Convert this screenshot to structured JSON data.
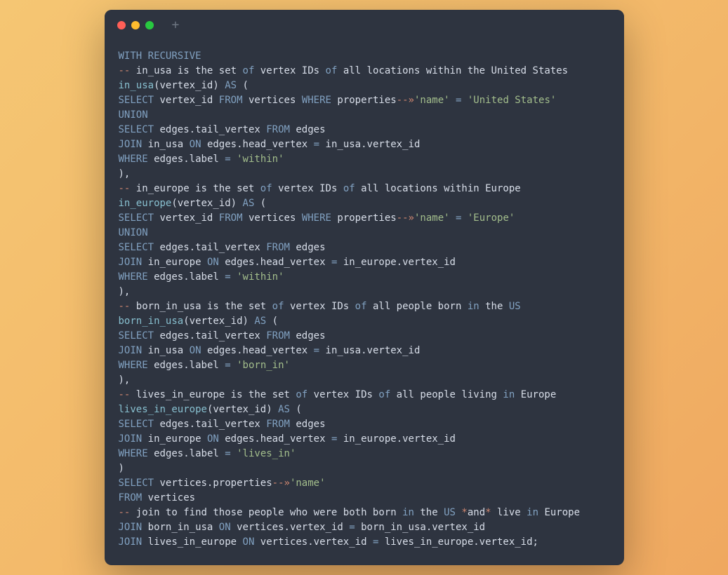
{
  "code": {
    "lines": [
      [
        {
          "t": "WITH RECURSIVE",
          "c": "kw"
        }
      ],
      [
        {
          "t": "--",
          "c": "cmt"
        },
        {
          "t": " in_usa is the set ",
          "c": ""
        },
        {
          "t": "of",
          "c": "kw2"
        },
        {
          "t": " vertex IDs ",
          "c": ""
        },
        {
          "t": "of",
          "c": "kw2"
        },
        {
          "t": " all locations within the United States",
          "c": ""
        }
      ],
      [
        {
          "t": "in_usa",
          "c": "fn"
        },
        {
          "t": "(vertex_id) ",
          "c": ""
        },
        {
          "t": "AS",
          "c": "kw"
        },
        {
          "t": " (",
          "c": ""
        }
      ],
      [
        {
          "t": "SELECT",
          "c": "kw"
        },
        {
          "t": " vertex_id ",
          "c": ""
        },
        {
          "t": "FROM",
          "c": "kw"
        },
        {
          "t": " vertices ",
          "c": ""
        },
        {
          "t": "WHERE",
          "c": "kw"
        },
        {
          "t": " properties",
          "c": ""
        },
        {
          "t": "--",
          "c": "arw"
        },
        {
          "t": "»",
          "c": "arw"
        },
        {
          "t": "'name'",
          "c": "str"
        },
        {
          "t": " ",
          "c": ""
        },
        {
          "t": "=",
          "c": "op"
        },
        {
          "t": " ",
          "c": ""
        },
        {
          "t": "'United States'",
          "c": "str"
        }
      ],
      [
        {
          "t": "UNION",
          "c": "kw"
        }
      ],
      [
        {
          "t": "SELECT",
          "c": "kw"
        },
        {
          "t": " edges.tail_vertex ",
          "c": ""
        },
        {
          "t": "FROM",
          "c": "kw"
        },
        {
          "t": " edges",
          "c": ""
        }
      ],
      [
        {
          "t": "JOIN",
          "c": "kw"
        },
        {
          "t": " in_usa ",
          "c": ""
        },
        {
          "t": "ON",
          "c": "kw"
        },
        {
          "t": " edges.head_vertex ",
          "c": ""
        },
        {
          "t": "=",
          "c": "op"
        },
        {
          "t": " in_usa.vertex_id",
          "c": ""
        }
      ],
      [
        {
          "t": "WHERE",
          "c": "kw"
        },
        {
          "t": " edges.label ",
          "c": ""
        },
        {
          "t": "=",
          "c": "op"
        },
        {
          "t": " ",
          "c": ""
        },
        {
          "t": "'within'",
          "c": "str"
        }
      ],
      [
        {
          "t": "),",
          "c": ""
        }
      ],
      [
        {
          "t": "--",
          "c": "cmt"
        },
        {
          "t": " in_europe is the set ",
          "c": ""
        },
        {
          "t": "of",
          "c": "kw2"
        },
        {
          "t": " vertex IDs ",
          "c": ""
        },
        {
          "t": "of",
          "c": "kw2"
        },
        {
          "t": " all locations within Europe",
          "c": ""
        }
      ],
      [
        {
          "t": "in_europe",
          "c": "fn"
        },
        {
          "t": "(vertex_id) ",
          "c": ""
        },
        {
          "t": "AS",
          "c": "kw"
        },
        {
          "t": " (",
          "c": ""
        }
      ],
      [
        {
          "t": "SELECT",
          "c": "kw"
        },
        {
          "t": " vertex_id ",
          "c": ""
        },
        {
          "t": "FROM",
          "c": "kw"
        },
        {
          "t": " vertices ",
          "c": ""
        },
        {
          "t": "WHERE",
          "c": "kw"
        },
        {
          "t": " properties",
          "c": ""
        },
        {
          "t": "--",
          "c": "arw"
        },
        {
          "t": "»",
          "c": "arw"
        },
        {
          "t": "'name'",
          "c": "str"
        },
        {
          "t": " ",
          "c": ""
        },
        {
          "t": "=",
          "c": "op"
        },
        {
          "t": " ",
          "c": ""
        },
        {
          "t": "'Europe'",
          "c": "str"
        }
      ],
      [
        {
          "t": "UNION",
          "c": "kw"
        }
      ],
      [
        {
          "t": "SELECT",
          "c": "kw"
        },
        {
          "t": " edges.tail_vertex ",
          "c": ""
        },
        {
          "t": "FROM",
          "c": "kw"
        },
        {
          "t": " edges",
          "c": ""
        }
      ],
      [
        {
          "t": "JOIN",
          "c": "kw"
        },
        {
          "t": " in_europe ",
          "c": ""
        },
        {
          "t": "ON",
          "c": "kw"
        },
        {
          "t": " edges.head_vertex ",
          "c": ""
        },
        {
          "t": "=",
          "c": "op"
        },
        {
          "t": " in_europe.vertex_id",
          "c": ""
        }
      ],
      [
        {
          "t": "WHERE",
          "c": "kw"
        },
        {
          "t": " edges.label ",
          "c": ""
        },
        {
          "t": "=",
          "c": "op"
        },
        {
          "t": " ",
          "c": ""
        },
        {
          "t": "'within'",
          "c": "str"
        }
      ],
      [
        {
          "t": "),",
          "c": ""
        }
      ],
      [
        {
          "t": "--",
          "c": "cmt"
        },
        {
          "t": " born_in_usa is the set ",
          "c": ""
        },
        {
          "t": "of",
          "c": "kw2"
        },
        {
          "t": " vertex IDs ",
          "c": ""
        },
        {
          "t": "of",
          "c": "kw2"
        },
        {
          "t": " all people born ",
          "c": ""
        },
        {
          "t": "in",
          "c": "kw2"
        },
        {
          "t": " the ",
          "c": ""
        },
        {
          "t": "US",
          "c": "us"
        }
      ],
      [
        {
          "t": "born_in_usa",
          "c": "fn"
        },
        {
          "t": "(vertex_id) ",
          "c": ""
        },
        {
          "t": "AS",
          "c": "kw"
        },
        {
          "t": " (",
          "c": ""
        }
      ],
      [
        {
          "t": "SELECT",
          "c": "kw"
        },
        {
          "t": " edges.tail_vertex ",
          "c": ""
        },
        {
          "t": "FROM",
          "c": "kw"
        },
        {
          "t": " edges",
          "c": ""
        }
      ],
      [
        {
          "t": "JOIN",
          "c": "kw"
        },
        {
          "t": " in_usa ",
          "c": ""
        },
        {
          "t": "ON",
          "c": "kw"
        },
        {
          "t": " edges.head_vertex ",
          "c": ""
        },
        {
          "t": "=",
          "c": "op"
        },
        {
          "t": " in_usa.vertex_id",
          "c": ""
        }
      ],
      [
        {
          "t": "WHERE",
          "c": "kw"
        },
        {
          "t": " edges.label ",
          "c": ""
        },
        {
          "t": "=",
          "c": "op"
        },
        {
          "t": " ",
          "c": ""
        },
        {
          "t": "'born_in'",
          "c": "str"
        }
      ],
      [
        {
          "t": "),",
          "c": ""
        }
      ],
      [
        {
          "t": "--",
          "c": "cmt"
        },
        {
          "t": " lives_in_europe is the set ",
          "c": ""
        },
        {
          "t": "of",
          "c": "kw2"
        },
        {
          "t": " vertex IDs ",
          "c": ""
        },
        {
          "t": "of",
          "c": "kw2"
        },
        {
          "t": " all people living ",
          "c": ""
        },
        {
          "t": "in",
          "c": "kw2"
        },
        {
          "t": " Europe",
          "c": ""
        }
      ],
      [
        {
          "t": "lives_in_europe",
          "c": "fn"
        },
        {
          "t": "(vertex_id) ",
          "c": ""
        },
        {
          "t": "AS",
          "c": "kw"
        },
        {
          "t": " (",
          "c": ""
        }
      ],
      [
        {
          "t": "SELECT",
          "c": "kw"
        },
        {
          "t": " edges.tail_vertex ",
          "c": ""
        },
        {
          "t": "FROM",
          "c": "kw"
        },
        {
          "t": " edges",
          "c": ""
        }
      ],
      [
        {
          "t": "JOIN",
          "c": "kw"
        },
        {
          "t": " in_europe ",
          "c": ""
        },
        {
          "t": "ON",
          "c": "kw"
        },
        {
          "t": " edges.head_vertex ",
          "c": ""
        },
        {
          "t": "=",
          "c": "op"
        },
        {
          "t": " in_europe.vertex_id",
          "c": ""
        }
      ],
      [
        {
          "t": "WHERE",
          "c": "kw"
        },
        {
          "t": " edges.label ",
          "c": ""
        },
        {
          "t": "=",
          "c": "op"
        },
        {
          "t": " ",
          "c": ""
        },
        {
          "t": "'lives_in'",
          "c": "str"
        }
      ],
      [
        {
          "t": ")",
          "c": ""
        }
      ],
      [
        {
          "t": "SELECT",
          "c": "kw"
        },
        {
          "t": " vertices.properties",
          "c": ""
        },
        {
          "t": "--",
          "c": "arw"
        },
        {
          "t": "»",
          "c": "arw"
        },
        {
          "t": "'name'",
          "c": "str"
        }
      ],
      [
        {
          "t": "FROM",
          "c": "kw"
        },
        {
          "t": " vertices",
          "c": ""
        }
      ],
      [
        {
          "t": "--",
          "c": "cmt"
        },
        {
          "t": " join to find those people who were both born ",
          "c": ""
        },
        {
          "t": "in",
          "c": "kw2"
        },
        {
          "t": " the ",
          "c": ""
        },
        {
          "t": "US",
          "c": "us"
        },
        {
          "t": " ",
          "c": ""
        },
        {
          "t": "*",
          "c": "star"
        },
        {
          "t": "and",
          "c": ""
        },
        {
          "t": "*",
          "c": "star"
        },
        {
          "t": " live ",
          "c": ""
        },
        {
          "t": "in",
          "c": "kw2"
        },
        {
          "t": " Europe",
          "c": ""
        }
      ],
      [
        {
          "t": "JOIN",
          "c": "kw"
        },
        {
          "t": " born_in_usa ",
          "c": ""
        },
        {
          "t": "ON",
          "c": "kw"
        },
        {
          "t": " vertices.vertex_id ",
          "c": ""
        },
        {
          "t": "=",
          "c": "op"
        },
        {
          "t": " born_in_usa.vertex_id",
          "c": ""
        }
      ],
      [
        {
          "t": "JOIN",
          "c": "kw"
        },
        {
          "t": " lives_in_europe ",
          "c": ""
        },
        {
          "t": "ON",
          "c": "kw"
        },
        {
          "t": " vertices.vertex_id ",
          "c": ""
        },
        {
          "t": "=",
          "c": "op"
        },
        {
          "t": " lives_in_europe.vertex_id;",
          "c": ""
        }
      ]
    ]
  }
}
